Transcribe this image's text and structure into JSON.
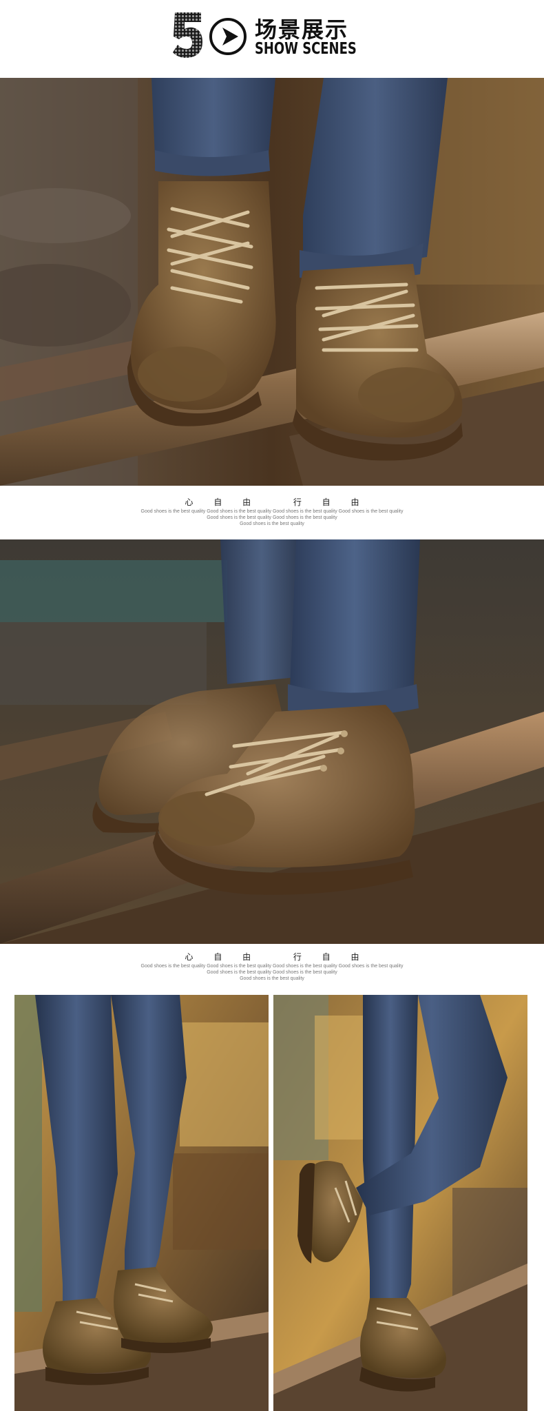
{
  "header": {
    "number": "5",
    "play_icon": "play-circle-icon",
    "title_cn": "场景展示",
    "title_en": "SHOW SCENES"
  },
  "photos": [
    {
      "subject": "two brown suede lace-up boots stepping on wooden beam, blue jeans"
    },
    {
      "subject": "brown suede boots close-up walking on rusty wooden beam"
    },
    {
      "subject": "full-length legs in blue jeans and brown boots standing on beam"
    },
    {
      "subject": "legs in blue jeans stepping forward in brown boots on beam"
    }
  ],
  "captions": [
    {
      "words_left": [
        "心",
        "自",
        "由"
      ],
      "words_right": [
        "行",
        "自",
        "由"
      ],
      "lines": [
        "Good shoes is the best quality Good shoes is the best quality Good shoes is the best quality Good shoes is the best quality",
        "Good shoes is the best quality Good shoes is the best quality",
        "Good shoes is the best quality"
      ]
    },
    {
      "words_left": [
        "心",
        "自",
        "由"
      ],
      "words_right": [
        "行",
        "自",
        "由"
      ],
      "lines": [
        "Good shoes is the best quality Good shoes is the best quality Good shoes is the best quality Good shoes is the best quality",
        "Good shoes is the best quality Good shoes is the best quality",
        "Good shoes is the best quality"
      ]
    }
  ],
  "colors": {
    "suede": "#8a6a42",
    "suede_dark": "#5e4326",
    "sole": "#6b4a2a",
    "denim": "#3e4f6c",
    "denim_dark": "#2a3650",
    "wood": "#7a5c3e",
    "rust": "#b07a3a",
    "background_warm": "#6a4a2a"
  }
}
